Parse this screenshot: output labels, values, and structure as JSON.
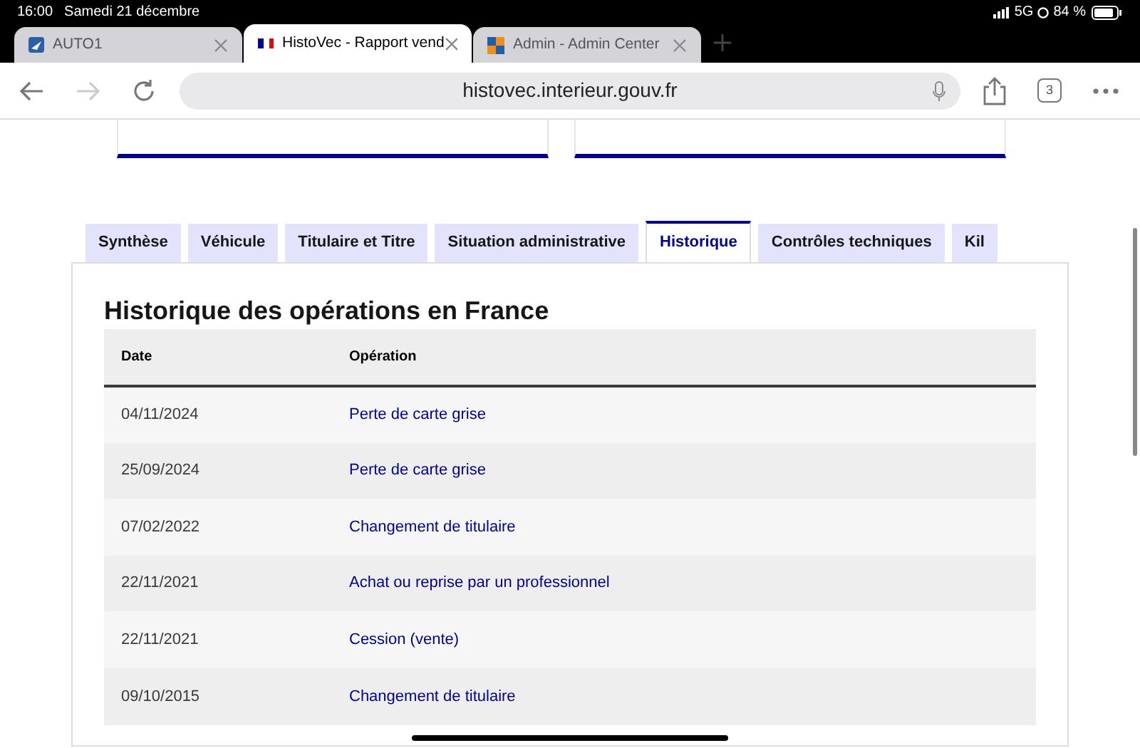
{
  "status_bar": {
    "time": "16:00",
    "date": "Samedi 21 décembre",
    "network": "5G",
    "battery": "84 %"
  },
  "browser_tabs": [
    {
      "title": "AUTO1",
      "selected": false,
      "kind": "auto"
    },
    {
      "title": "HistoVec - Rapport vend",
      "selected": true,
      "kind": "flag"
    },
    {
      "title": "Admin - Admin Center",
      "selected": false,
      "kind": "squares"
    }
  ],
  "address_bar": {
    "url": "histovec.interieur.gouv.fr",
    "tab_count": "3"
  },
  "page_tabs": [
    {
      "label": "Synthèse",
      "selected": false
    },
    {
      "label": "Véhicule",
      "selected": false
    },
    {
      "label": "Titulaire et Titre",
      "selected": false
    },
    {
      "label": "Situation administrative",
      "selected": false
    },
    {
      "label": "Historique",
      "selected": true
    },
    {
      "label": "Contrôles techniques",
      "selected": false
    },
    {
      "label": "Kil",
      "selected": false
    }
  ],
  "section": {
    "title": "Historique des opérations en France",
    "table": {
      "columns": [
        "Date",
        "Opération"
      ],
      "rows": [
        {
          "date": "04/11/2024",
          "operation": "Perte de carte grise"
        },
        {
          "date": "25/09/2024",
          "operation": "Perte de carte grise"
        },
        {
          "date": "07/02/2022",
          "operation": "Changement de titulaire"
        },
        {
          "date": "22/11/2021",
          "operation": "Achat ou reprise par un professionnel"
        },
        {
          "date": "22/11/2021",
          "operation": "Cession (vente)"
        },
        {
          "date": "09/10/2015",
          "operation": "Changement de titulaire"
        }
      ]
    }
  }
}
